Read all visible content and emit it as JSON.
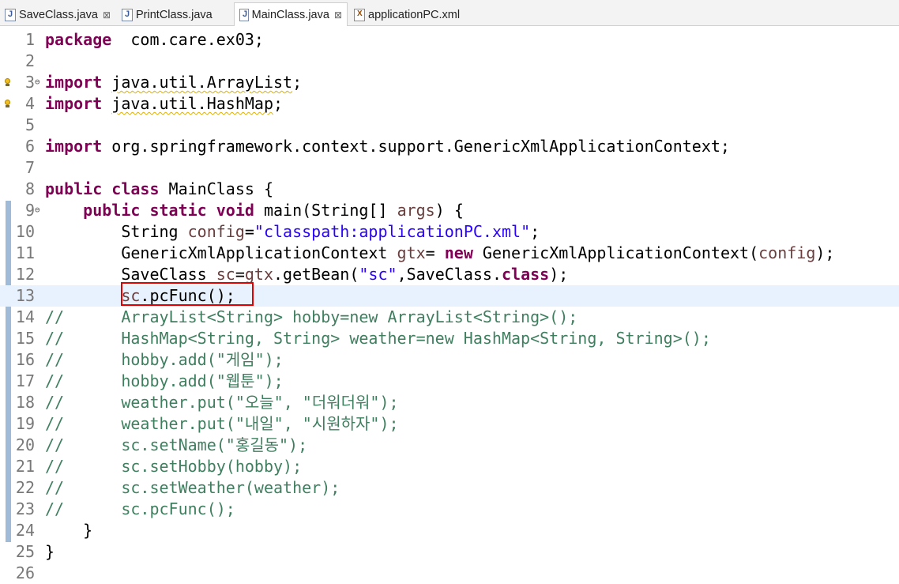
{
  "tabs": [
    {
      "label": "SaveClass.java",
      "icon": "java-file-icon",
      "close": "⊠",
      "active": false
    },
    {
      "label": "PrintClass.java",
      "icon": "java-file-icon",
      "close": "",
      "active": false
    },
    {
      "label": "MainClass.java",
      "icon": "java-file-icon",
      "close": "⊠",
      "active": true
    },
    {
      "label": "applicationPC.xml",
      "icon": "xml-file-icon",
      "close": "",
      "active": false
    }
  ],
  "lines": [
    {
      "n": "1",
      "t": [
        [
          "kw",
          "package"
        ],
        [
          "",
          "  com.care.ex03;"
        ]
      ]
    },
    {
      "n": "2",
      "t": []
    },
    {
      "n": "3",
      "fold": "⊖",
      "warn": true,
      "t": [
        [
          "kw",
          "import"
        ],
        [
          "",
          " "
        ],
        [
          "warn",
          "java.util.ArrayList"
        ],
        [
          "",
          ";"
        ]
      ]
    },
    {
      "n": "4",
      "warn": true,
      "t": [
        [
          "kw",
          "import"
        ],
        [
          "",
          " "
        ],
        [
          "warn",
          "java.util.HashMap"
        ],
        [
          "",
          ";"
        ]
      ]
    },
    {
      "n": "5",
      "t": []
    },
    {
      "n": "6",
      "t": [
        [
          "kw",
          "import"
        ],
        [
          "",
          " org.springframework.context.support.GenericXmlApplicationContext;"
        ]
      ]
    },
    {
      "n": "7",
      "t": []
    },
    {
      "n": "8",
      "t": [
        [
          "kw",
          "public"
        ],
        [
          "",
          " "
        ],
        [
          "kw",
          "class"
        ],
        [
          "",
          " MainClass {"
        ]
      ]
    },
    {
      "n": "9",
      "fold": "⊖",
      "t": [
        [
          "",
          "    "
        ],
        [
          "kw",
          "public"
        ],
        [
          "",
          " "
        ],
        [
          "kw",
          "static"
        ],
        [
          "",
          " "
        ],
        [
          "kw",
          "void"
        ],
        [
          "",
          " main(String[] "
        ],
        [
          "var",
          "args"
        ],
        [
          "",
          ") {"
        ]
      ]
    },
    {
      "n": "10",
      "t": [
        [
          "",
          "        String "
        ],
        [
          "var",
          "config"
        ],
        [
          "",
          "="
        ],
        [
          "str",
          "\"classpath:applicationPC.xml\""
        ],
        [
          "",
          ";"
        ]
      ]
    },
    {
      "n": "11",
      "t": [
        [
          "",
          "        GenericXmlApplicationContext "
        ],
        [
          "var",
          "gtx"
        ],
        [
          "",
          "= "
        ],
        [
          "kw",
          "new"
        ],
        [
          "",
          " GenericXmlApplicationContext("
        ],
        [
          "var",
          "config"
        ],
        [
          "",
          ");"
        ]
      ]
    },
    {
      "n": "12",
      "t": [
        [
          "",
          "        SaveClass "
        ],
        [
          "var",
          "sc"
        ],
        [
          "",
          "="
        ],
        [
          "var",
          "gtx"
        ],
        [
          "",
          ".getBean("
        ],
        [
          "str",
          "\"sc\""
        ],
        [
          "",
          ",SaveClass."
        ],
        [
          "kw",
          "class"
        ],
        [
          "",
          ");"
        ]
      ]
    },
    {
      "n": "13",
      "current": true,
      "t": [
        [
          "",
          "        "
        ],
        [
          "var",
          "sc"
        ],
        [
          "",
          ".pcFunc();"
        ]
      ]
    },
    {
      "n": "14",
      "t": [
        [
          "cmt",
          "//      ArrayList<String> hobby=new ArrayList<String>();"
        ]
      ]
    },
    {
      "n": "15",
      "t": [
        [
          "cmt",
          "//      HashMap<String, String> weather=new HashMap<String, String>();"
        ]
      ]
    },
    {
      "n": "16",
      "t": [
        [
          "cmt",
          "//      hobby.add(\"게임\");"
        ]
      ]
    },
    {
      "n": "17",
      "t": [
        [
          "cmt",
          "//      hobby.add(\"웹툰\");"
        ]
      ]
    },
    {
      "n": "18",
      "t": [
        [
          "cmt",
          "//      weather.put(\"오늘\", \"더워더워\");"
        ]
      ]
    },
    {
      "n": "19",
      "t": [
        [
          "cmt",
          "//      weather.put(\"내일\", \"시원하자\");"
        ]
      ]
    },
    {
      "n": "20",
      "t": [
        [
          "cmt",
          "//      sc.setName(\"홍길동\");"
        ]
      ]
    },
    {
      "n": "21",
      "t": [
        [
          "cmt",
          "//      sc.setHobby(hobby);"
        ]
      ]
    },
    {
      "n": "22",
      "t": [
        [
          "cmt",
          "//      sc.setWeather(weather);"
        ]
      ]
    },
    {
      "n": "23",
      "t": [
        [
          "cmt",
          "//      sc.pcFunc();"
        ]
      ]
    },
    {
      "n": "24",
      "t": [
        [
          "",
          "    }"
        ]
      ]
    },
    {
      "n": "25",
      "t": [
        [
          "",
          "}"
        ]
      ]
    },
    {
      "n": "26",
      "t": []
    }
  ]
}
